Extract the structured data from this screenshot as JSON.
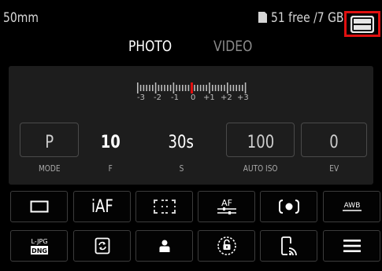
{
  "status": {
    "focal_length": "50mm",
    "storage": "51 free /7 GB",
    "card_icon": "sd-card-icon",
    "battery_icon": "battery-icon"
  },
  "tabs": [
    {
      "label": "PHOTO",
      "active": true
    },
    {
      "label": "VIDEO",
      "active": false
    }
  ],
  "exposure_scale": {
    "labels": [
      "-3",
      "-2",
      "-1",
      "0",
      "+1",
      "+2",
      "+3"
    ],
    "current_value": 0,
    "indicator_color": "#e01010"
  },
  "parameters": [
    {
      "value": "P",
      "label": "MODE"
    },
    {
      "value": "10",
      "label": "F"
    },
    {
      "value": "30s",
      "label": "S"
    },
    {
      "value": "100",
      "label": "AUTO ISO"
    },
    {
      "value": "0",
      "label": "EV"
    }
  ],
  "buttons_row1": [
    {
      "icon": "single-frame-icon"
    },
    {
      "icon": "iaf-icon",
      "text": "iAF"
    },
    {
      "icon": "metering-field-icon"
    },
    {
      "icon": "af-settings-icon",
      "text": "AF"
    },
    {
      "icon": "spot-metering-icon"
    },
    {
      "icon": "white-balance-icon",
      "text": "AWB"
    }
  ],
  "buttons_row2": [
    {
      "icon": "file-format-icon",
      "text_top": "L-JPG",
      "text_bottom": "DNG"
    },
    {
      "icon": "image-stabilization-icon"
    },
    {
      "icon": "user-profile-icon"
    },
    {
      "icon": "unlock-icon"
    },
    {
      "icon": "phone-connection-icon"
    },
    {
      "icon": "menu-icon"
    }
  ],
  "colors": {
    "background": "#000000",
    "panel": "#1d1d1d",
    "highlight": "#e01010",
    "inactive_text": "#8a8a8a"
  }
}
